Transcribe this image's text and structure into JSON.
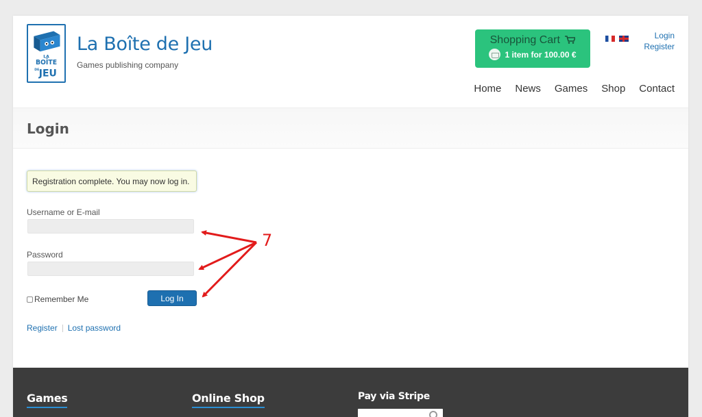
{
  "header": {
    "site_title": "La Boîte de Jeu",
    "tagline": "Games publishing company",
    "logo_text": [
      "LA",
      "BOÎTE",
      "DE",
      "JEU"
    ]
  },
  "cart": {
    "title": "Shopping Cart",
    "summary": "1 item for 100.00 €"
  },
  "top_links": {
    "login": "Login",
    "register": "Register"
  },
  "languages": [
    "fr",
    "en"
  ],
  "nav": {
    "items": [
      "Home",
      "News",
      "Games",
      "Shop",
      "Contact"
    ]
  },
  "page": {
    "title": "Login"
  },
  "form": {
    "notice": "Registration complete. You may now log in.",
    "username_label": "Username or E-mail",
    "username_value": "",
    "password_label": "Password",
    "password_value": "",
    "remember_label": "Remember Me",
    "remember_checked": false,
    "submit_label": "Log In",
    "register_link": "Register",
    "lost_password_link": "Lost password"
  },
  "annotation": {
    "label": "7",
    "color": "#e21b1b"
  },
  "footer": {
    "col1": "Games",
    "col2": "Online Shop",
    "col3": "Pay via Stripe"
  },
  "colors": {
    "brand_blue": "#1e70b0",
    "cart_green": "#2bc37d",
    "footer_bg": "#3c3c3c"
  }
}
